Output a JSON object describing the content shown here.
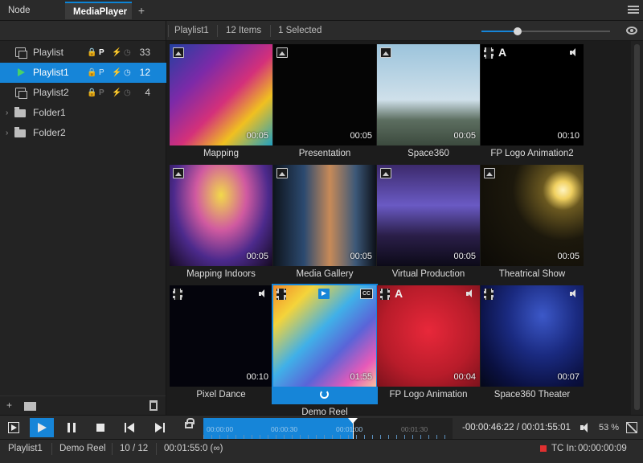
{
  "tabs": [
    {
      "label": "Node Graph"
    },
    {
      "label": "MediaPlayer"
    }
  ],
  "tab_add": "+",
  "sidebar": {
    "items": [
      {
        "label": "Playlist",
        "flag_p": "P",
        "count": "33"
      },
      {
        "label": "Playlist1",
        "flag_p": "P",
        "count": "12"
      },
      {
        "label": "Playlist2",
        "flag_p": "P",
        "count": "4"
      },
      {
        "label": "Folder1"
      },
      {
        "label": "Folder2"
      }
    ],
    "add_label": "+"
  },
  "media_header": {
    "playlist": "Playlist1",
    "items": "12 Items",
    "selected": "1 Selected",
    "thumb_size_fraction": 0.28
  },
  "media": [
    {
      "caption": "Mapping",
      "duration": "00:05",
      "type": "image-icon",
      "art": "art-mapping"
    },
    {
      "caption": "Presentation",
      "duration": "00:05",
      "type": "image-icon",
      "art": "art-presentation"
    },
    {
      "caption": "Space360",
      "duration": "00:05",
      "type": "image-icon",
      "art": "art-space360"
    },
    {
      "caption": "FP Logo Animation2",
      "duration": "00:10",
      "type": "film-icon",
      "alpha": "A",
      "audio": true,
      "art": "art-fplogo"
    },
    {
      "caption": "Mapping Indoors",
      "duration": "00:05",
      "type": "image-icon",
      "art": "art-indoors"
    },
    {
      "caption": "Media Gallery",
      "duration": "00:05",
      "type": "image-icon",
      "art": "art-gallery"
    },
    {
      "caption": "Virtual Production",
      "duration": "00:05",
      "type": "image-icon",
      "art": "art-virtual"
    },
    {
      "caption": "Theatrical Show",
      "duration": "00:05",
      "type": "image-icon",
      "art": "art-theatrical"
    },
    {
      "caption": "Pixel Dance",
      "duration": "00:10",
      "type": "film-icon",
      "audio": true,
      "art": "art-pixel"
    },
    {
      "caption": "Demo Reel",
      "duration": "01:55",
      "type": "film-icon",
      "playing": true,
      "cc": "CC",
      "art": "art-demo"
    },
    {
      "caption": "FP Logo Animation",
      "duration": "00:04",
      "type": "film-icon",
      "alpha": "A",
      "audio": true,
      "art": "art-fpanim"
    },
    {
      "caption": "Space360 Theater",
      "duration": "00:07",
      "type": "film-icon",
      "audio": true,
      "art": "art-theater"
    }
  ],
  "transport": {
    "timeline_ticks": [
      "00:00:00",
      "00:00:30",
      "00:01:00",
      "00:01:30"
    ],
    "timecode": "-00:00:46:22 / 00:01:55:01",
    "volume": "53 %",
    "progress_fraction": 0.6
  },
  "status": {
    "playlist": "Playlist1",
    "media": "Demo Reel",
    "position": "10 / 12",
    "duration": "00:01:55:0 (∞)",
    "tc_in": "TC In:",
    "tc_value": "00:00:00:09"
  },
  "colors": {
    "accent": "#1685d8",
    "play_green": "#48d16a",
    "record_red": "#e03030"
  }
}
